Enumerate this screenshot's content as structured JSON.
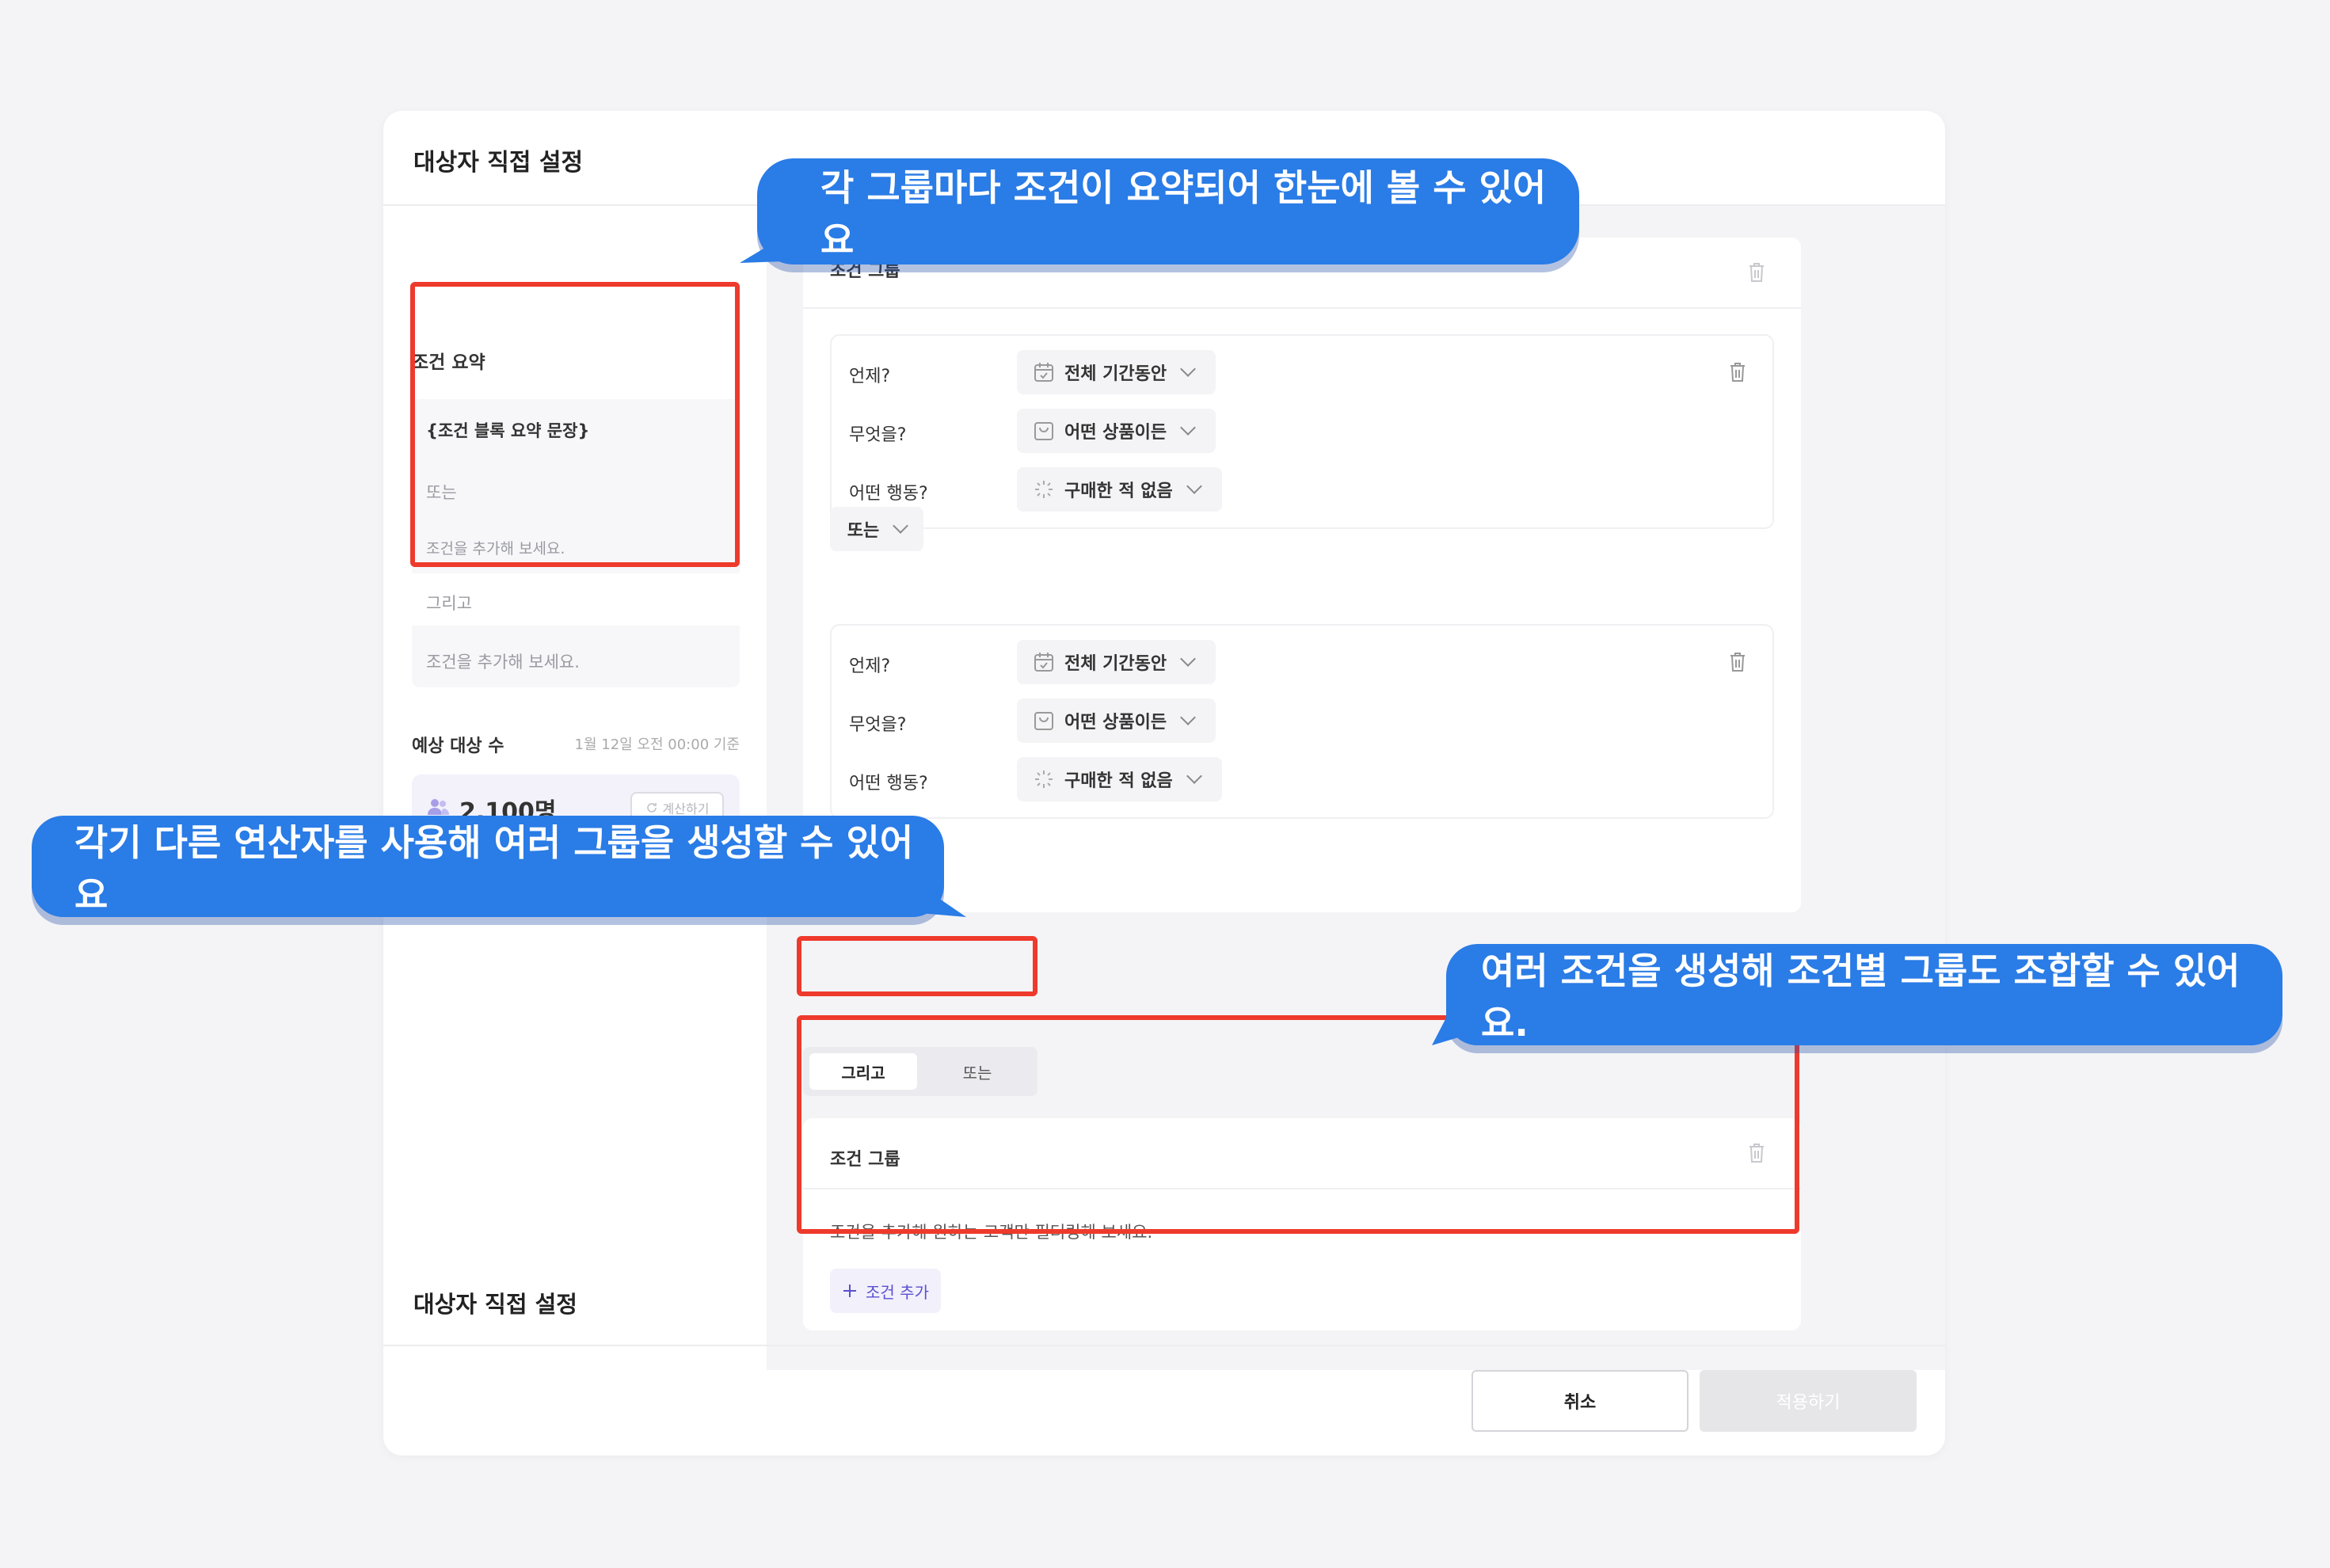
{
  "panel": {
    "title": "대상자 직접 설정"
  },
  "summary": {
    "label": "조건 요약",
    "block_sentence": "{조건 블록 요약 문장}",
    "or_text": "또는",
    "add_prompt_1": "조건을 추가해 보세요.",
    "and_text": "그리고",
    "add_prompt_2": "조건을 추가해 보세요."
  },
  "estimate": {
    "label": "예상 대상 수",
    "as_of": "1월 12일 오전 00:00 기준",
    "count": "2,100명",
    "calc_button": "계산하기"
  },
  "group1": {
    "title": "조건 그룹",
    "cards": [
      {
        "rows": [
          {
            "question": "언제?",
            "value": "전체 기간동안",
            "icon": "calendar-icon"
          },
          {
            "question": "무엇을?",
            "value": "어떤 상품이든",
            "icon": "bag-icon"
          },
          {
            "question": "어떤 행동?",
            "value": "구매한 적 없음",
            "icon": "loading-icon"
          }
        ]
      },
      {
        "rows": [
          {
            "question": "언제?",
            "value": "전체 기간동안",
            "icon": "calendar-icon"
          },
          {
            "question": "무엇을?",
            "value": "어떤 상품이든",
            "icon": "bag-icon"
          },
          {
            "question": "어떤 행동?",
            "value": "구매한 적 없음",
            "icon": "loading-icon"
          }
        ]
      }
    ],
    "operator": "또는"
  },
  "toggle": {
    "and_label": "그리고",
    "or_label": "또는",
    "selected": "그리고"
  },
  "group2": {
    "title": "조건 그룹",
    "description": "조건을 추가해 원하는 고객만 필터링해 보세요.",
    "add_button": "조건 추가"
  },
  "footer": {
    "title": "대상자 직접 설정",
    "cancel": "취소",
    "apply": "적용하기"
  },
  "callouts": {
    "top": "각 그룹마다 조건이 요약되어 한눈에 볼 수 있어요",
    "left": "각기 다른 연산자를 사용해 여러 그룹을 생성할 수 있어요",
    "right": "여러 조건을 생성해 조건별 그룹도 조합할 수 있어요."
  },
  "colors": {
    "highlight": "#ee3a2c",
    "callout": "#2a7ce6",
    "accent": "#5a4fd0"
  }
}
